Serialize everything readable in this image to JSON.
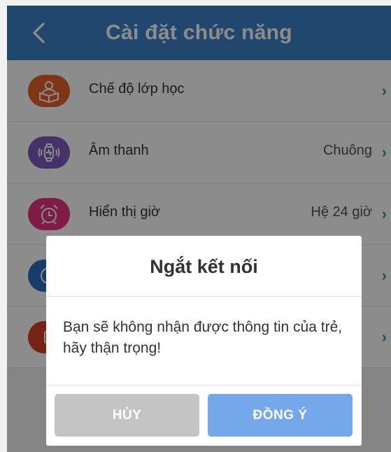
{
  "header": {
    "title": "Cài đặt chức năng"
  },
  "settings": [
    {
      "label": "Chế độ lớp học",
      "value": "",
      "icon": "classroom-book-icon",
      "color": "#e8622a"
    },
    {
      "label": "Âm thanh",
      "value": "Chuông",
      "icon": "watch-vibrate-icon",
      "color": "#7e5cc0"
    },
    {
      "label": "Hiển thị giờ",
      "value": "Hệ 24 giờ",
      "icon": "alarm-clock-icon",
      "color": "#e8347e"
    },
    {
      "label": "",
      "value": "",
      "icon": "clock-icon",
      "color": "#2a6fc4"
    },
    {
      "label": "",
      "value": "",
      "icon": "device-icon",
      "color": "#d8402a"
    }
  ],
  "dialog": {
    "title": "Ngắt kết nối",
    "message": "Bạn sẽ không nhận được thông tin của trẻ, hãy thận trọng!",
    "cancel_label": "HỦY",
    "ok_label": "ĐỒNG Ý"
  },
  "colors": {
    "header": "#3f82c9",
    "chevron": "#2aa198",
    "ok_button": "#74a8ea",
    "cancel_button": "#c4c4c4"
  }
}
